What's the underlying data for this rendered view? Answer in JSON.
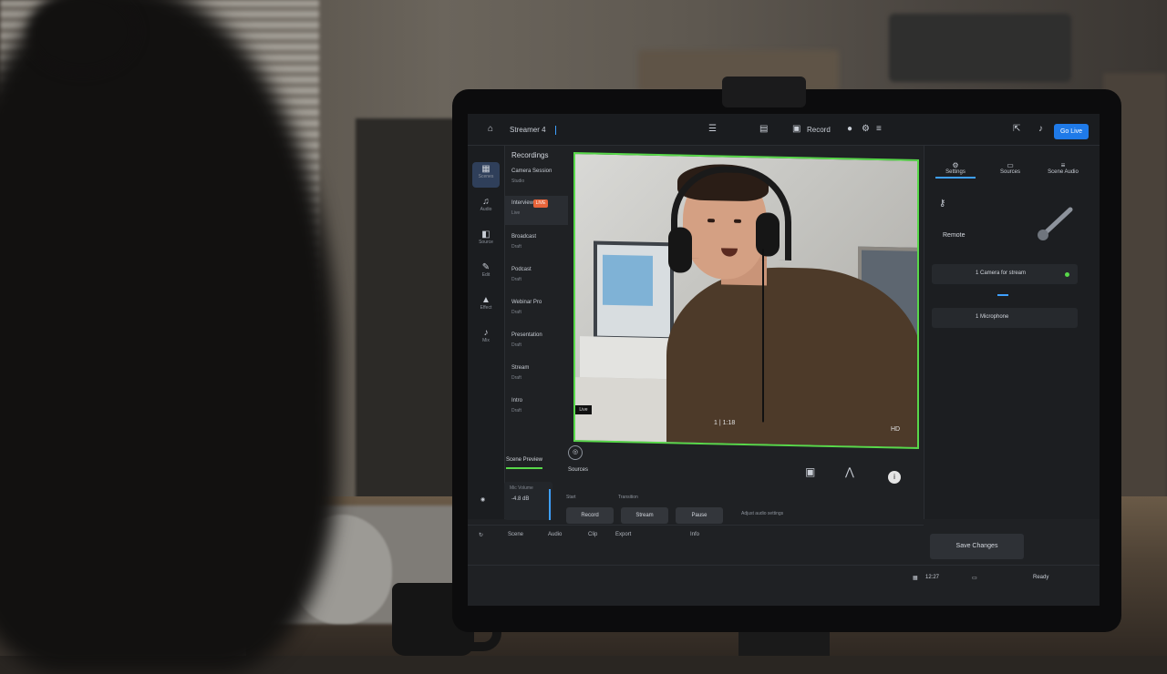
{
  "topbar": {
    "app_name": "Streamer 4",
    "menu_label": "Record",
    "primary_button": "Go Live"
  },
  "rail": [
    {
      "label": "Scenes"
    },
    {
      "label": "Audio"
    },
    {
      "label": "Source"
    },
    {
      "label": "Edit"
    },
    {
      "label": "Effect"
    },
    {
      "label": "Mix"
    }
  ],
  "panel": {
    "title": "Recordings",
    "items": [
      {
        "title": "Camera Session",
        "sub": "Studio"
      },
      {
        "title": "Interview",
        "sub": "Live",
        "badge": "LIVE"
      },
      {
        "title": "Broadcast",
        "sub": "Draft"
      },
      {
        "title": "Podcast",
        "sub": "Draft"
      },
      {
        "title": "Webinar Pro",
        "sub": "Draft"
      },
      {
        "title": "Presentation",
        "sub": "Draft"
      },
      {
        "title": "Stream",
        "sub": "Draft"
      },
      {
        "title": "Intro",
        "sub": "Draft"
      }
    ]
  },
  "video": {
    "corner_left": "Live",
    "bottom_center": "1 | 1:18",
    "bottom_right": "HD"
  },
  "tabs": {
    "scene_tab": "Scene Preview",
    "sources_tab": "Sources"
  },
  "right_panel": {
    "tabs": [
      "Settings",
      "Sources",
      "Scene Audio"
    ],
    "section_label": "Remote",
    "row1": "1 Camera for stream",
    "row2": "1 Microphone",
    "save_button": "Save Changes"
  },
  "bottom": {
    "meter_title": "Mic Volume",
    "meter_value": "-4.8 dB",
    "labels": [
      "Start",
      "Transition"
    ],
    "pills": [
      "Record",
      "Stream",
      "Pause"
    ],
    "hint": "Adjust audio settings"
  },
  "statusbar": [
    "Scene",
    "Audio",
    "Clip",
    "Export",
    "Info"
  ],
  "footer": {
    "time": "12:27",
    "right": "Ready"
  },
  "colors": {
    "accent_blue": "#1f7ae8",
    "live_green": "#58d84a",
    "badge_orange": "#e8643a"
  }
}
